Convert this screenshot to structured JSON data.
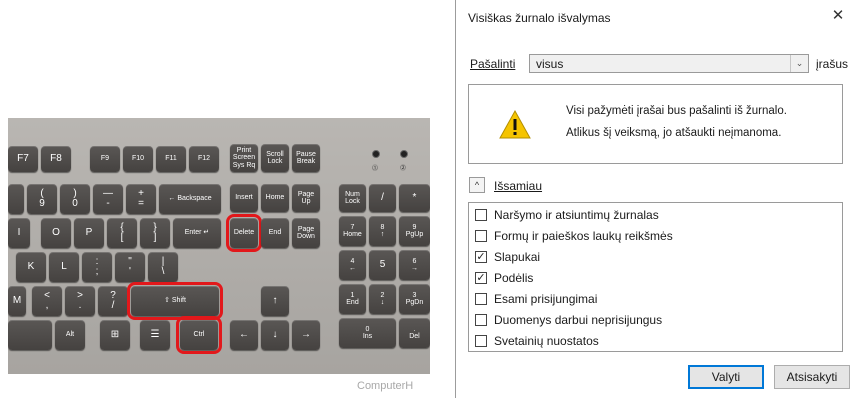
{
  "keyboard": {
    "watermark": "ComputerH",
    "fkeys": [
      "F7",
      "F8",
      "F9",
      "F10",
      "F11",
      "F12"
    ],
    "nav_top": [
      "Print\nScreen\nSys Rq",
      "Scroll\nLock",
      "Pause\nBreak"
    ],
    "nav_mid1": [
      "Insert",
      "Home",
      "Page\nUp"
    ],
    "nav_mid2": [
      "Delete",
      "End",
      "Page\nDown"
    ],
    "num_row": [
      "(\n9",
      ")\n0",
      "—\n-",
      "+\n=",
      "← Backspace"
    ],
    "q_row": [
      "I",
      "O",
      "P",
      "{\n[",
      "}\n]",
      "Enter ↵"
    ],
    "a_row": [
      "K",
      "L",
      ":\n;",
      "\"\n'",
      "|\n\\"
    ],
    "z_row": [
      "M",
      "<\n,",
      ">\n.",
      "?\n/",
      "⇧ Shift"
    ],
    "bottom_row": [
      "Alt",
      "⊞",
      "☰",
      "Ctrl"
    ],
    "arrows": [
      "↑",
      "←",
      "↓",
      "→"
    ],
    "numpad": [
      "Num\nLock",
      "/",
      "*",
      "7\nHome",
      "8\n↑",
      "9\nPgUp",
      "4\n←",
      "5",
      "6\n→",
      "1\nEnd",
      "2\n↓",
      "3\nPgDn",
      "0\nIns",
      ".\nDel"
    ],
    "led_labels": [
      "⓵",
      "⓶"
    ]
  },
  "dialog": {
    "title": "Visiškas žurnalo išvalymas",
    "close_glyph": "✕",
    "remove_label": "Pašalinti",
    "remove_value": "visus",
    "records_label": "įrašus",
    "warning_line1": "Visi pažymėti įrašai bus pašalinti iš žurnalo.",
    "warning_line2": "Atlikus šį veiksmą, jo atšaukti neįmanoma.",
    "details_glyph": "^",
    "details_label": "Išsamiau",
    "items": [
      {
        "label": "Naršymo ir atsiuntimų žurnalas",
        "checked": false
      },
      {
        "label": "Formų ir paieškos laukų reikšmės",
        "checked": false
      },
      {
        "label": "Slapukai",
        "checked": true
      },
      {
        "label": "Podėlis",
        "checked": true
      },
      {
        "label": "Esami prisijungimai",
        "checked": false
      },
      {
        "label": "Duomenys darbui neprisijungus",
        "checked": false
      },
      {
        "label": "Svetainių nuostatos",
        "checked": false
      }
    ],
    "clear_button": "Valyti",
    "cancel_button": "Atsisakyti",
    "colors": {
      "accent": "#0078d7",
      "highlight": "#e2181b"
    }
  }
}
